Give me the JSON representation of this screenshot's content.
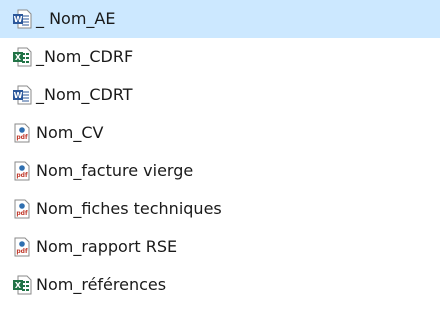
{
  "file_list": {
    "items": [
      {
        "name": "_ Nom_AE",
        "type": "word",
        "selected": true
      },
      {
        "name": "_Nom_CDRF",
        "type": "excel",
        "selected": false
      },
      {
        "name": "_Nom_CDRT",
        "type": "word",
        "selected": false
      },
      {
        "name": "Nom_CV",
        "type": "pdf",
        "selected": false
      },
      {
        "name": "Nom_facture vierge",
        "type": "pdf",
        "selected": false
      },
      {
        "name": "Nom_fiches techniques",
        "type": "pdf",
        "selected": false
      },
      {
        "name": "Nom_rapport RSE",
        "type": "pdf",
        "selected": false
      },
      {
        "name": "Nom_références",
        "type": "excel",
        "selected": false
      }
    ]
  },
  "icons": {
    "word": "word-document-icon",
    "excel": "excel-spreadsheet-icon",
    "pdf": "pdf-document-icon"
  },
  "colors": {
    "selection": "#cce8ff",
    "word": "#2b579a",
    "excel": "#217346",
    "pdf_accent": "#2f6fb0"
  }
}
